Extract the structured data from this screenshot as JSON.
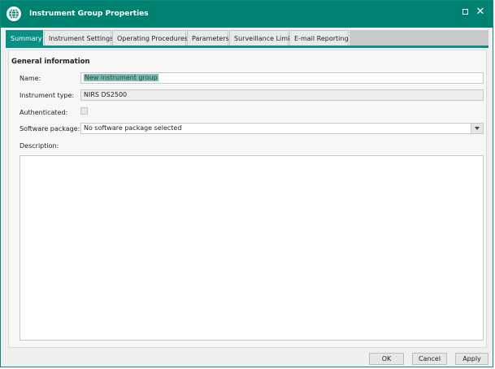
{
  "window": {
    "title": "Instrument Group Properties",
    "accent_color": "#008272",
    "icon": "globe-icon"
  },
  "tabs": [
    {
      "label": "Summary",
      "active": true
    },
    {
      "label": "Instrument Settings",
      "active": false
    },
    {
      "label": "Operating Procedures",
      "active": false
    },
    {
      "label": "Parameters",
      "active": false
    },
    {
      "label": "Surveillance Limits",
      "active": false
    },
    {
      "label": "E-mail Reporting",
      "active": false
    }
  ],
  "general": {
    "section_title": "General information",
    "name_label": "Name:",
    "name_value": "New instrument group",
    "instrument_type_label": "Instrument type:",
    "instrument_type_value": "NIRS DS2500",
    "authenticated_label": "Authenticated:",
    "authenticated_checked": false,
    "software_package_label": "Software package:",
    "software_package_value": "No software package selected",
    "description_label": "Description:",
    "description_value": ""
  },
  "footer": {
    "ok_label": "OK",
    "cancel_label": "Cancel",
    "apply_label": "Apply"
  }
}
